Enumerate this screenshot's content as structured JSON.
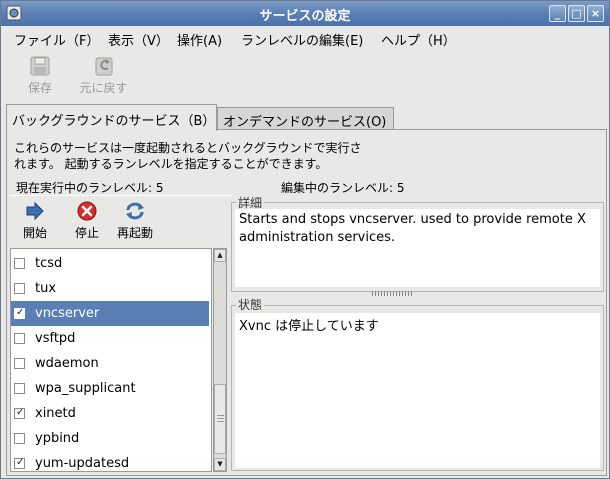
{
  "window": {
    "title": "サービスの設定",
    "controls": [
      "_",
      "□",
      "×"
    ]
  },
  "menu": [
    "ファイル（F）",
    "表示（V）",
    "操作(A)",
    "ランレベルの編集(E)",
    "ヘルプ（H）"
  ],
  "toolbar": {
    "save": "保存",
    "revert": "元に戻す"
  },
  "tabs": {
    "background": "バックグラウンドのサービス（B）",
    "ondemand": "オンデマンドのサービス(O)"
  },
  "description": {
    "line1": "これらのサービスは一度起動されるとバックグラウンドで実行さ",
    "line2": "れます。 起動するランレベルを指定することができます。"
  },
  "runlevel": {
    "current": "現在実行中のランレベル: 5",
    "editing": "編集中のランレベル: 5"
  },
  "actions": {
    "start": "開始",
    "stop": "停止",
    "restart": "再起動"
  },
  "services": [
    {
      "name": "tcsd",
      "checked": false,
      "selected": false
    },
    {
      "name": "tux",
      "checked": false,
      "selected": false
    },
    {
      "name": "vncserver",
      "checked": true,
      "selected": true
    },
    {
      "name": "vsftpd",
      "checked": false,
      "selected": false
    },
    {
      "name": "wdaemon",
      "checked": false,
      "selected": false
    },
    {
      "name": "wpa_supplicant",
      "checked": false,
      "selected": false
    },
    {
      "name": "xinetd",
      "checked": true,
      "selected": false
    },
    {
      "name": "ypbind",
      "checked": false,
      "selected": false
    },
    {
      "name": "yum-updatesd",
      "checked": true,
      "selected": false
    }
  ],
  "detail": {
    "label": "詳細",
    "text": "Starts and stops vncserver. used to provide remote X administration services."
  },
  "status": {
    "label": "状態",
    "text": "Xvnc は停止しています"
  },
  "colors": {
    "titlebar": "#5a7fb5",
    "selection": "#5a7fb5",
    "stop_icon": "#d62c2c",
    "start_icon": "#3c6fb0"
  }
}
